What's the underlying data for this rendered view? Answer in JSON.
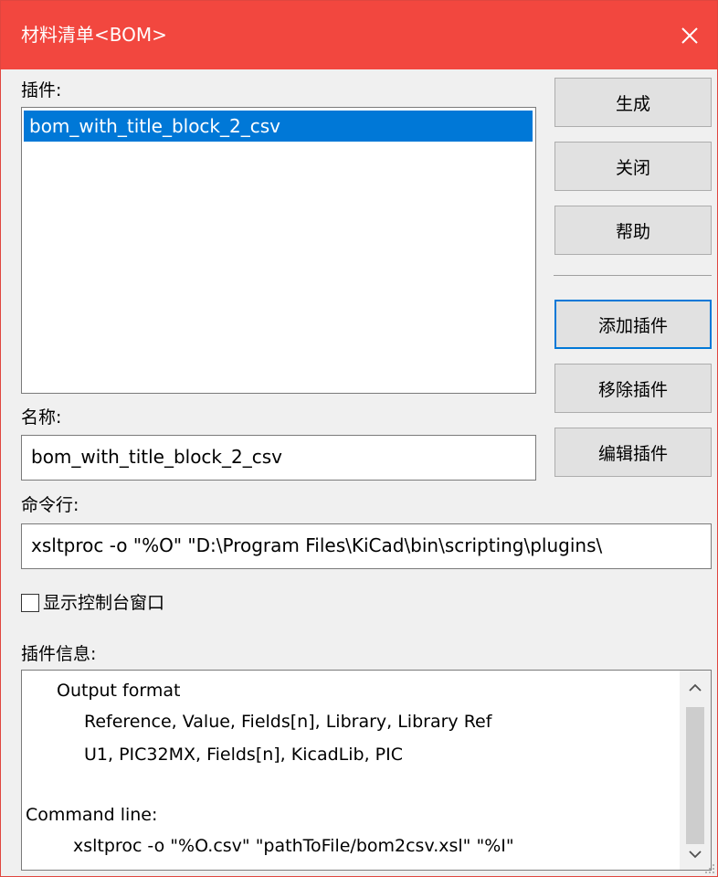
{
  "window": {
    "title": "材料清单<BOM>",
    "close_icon": "close-icon"
  },
  "plugins": {
    "label": "插件:",
    "items": [
      "bom_with_title_block_2_csv"
    ]
  },
  "name": {
    "label": "名称:",
    "value": "bom_with_title_block_2_csv"
  },
  "command": {
    "label": "命令行:",
    "value": "xsltproc -o \"%O\" \"D:\\Program Files\\KiCad\\bin\\scripting\\plugins\\"
  },
  "buttons": {
    "generate": "生成",
    "close": "关闭",
    "help": "帮助",
    "add_plugin": "添加插件",
    "remove_plugin": "移除插件",
    "edit_plugin": "编辑插件"
  },
  "console_checkbox": {
    "label": "显示控制台窗口",
    "checked": false
  },
  "plugin_info": {
    "label": "插件信息:",
    "lines": [
      "Output format",
      "Reference, Value, Fields[n], Library, Library Ref",
      "U1, PIC32MX, Fields[n], KicadLib, PIC",
      "Command line:",
      "xsltproc -o \"%O.csv\" \"pathToFile/bom2csv.xsl\" \"%I\""
    ]
  },
  "colors": {
    "titlebar": "#f2473f",
    "selection": "#0078d7",
    "focus_border": "#0078d7"
  }
}
